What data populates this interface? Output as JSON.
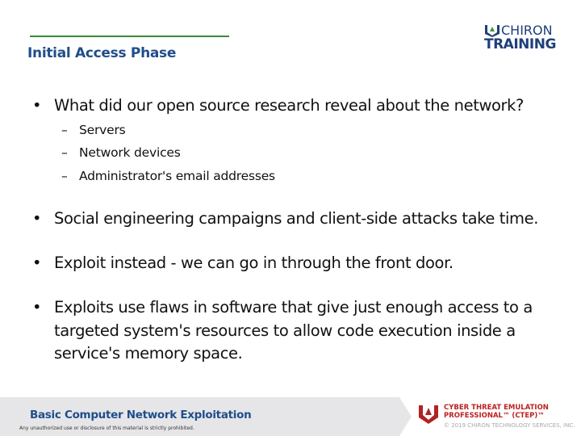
{
  "header": {
    "title": "Initial Access Phase",
    "logo": {
      "line1": "CHIRON",
      "line2": "TRAINING"
    }
  },
  "bullets": [
    {
      "text": "What did our open source research reveal about the network?",
      "sub": [
        "Servers",
        "Network devices",
        "Administrator's email addresses"
      ]
    },
    {
      "text": "Social engineering campaigns and client-side attacks take time."
    },
    {
      "text": "Exploit instead - we can go in through the front door."
    },
    {
      "text": "Exploits use flaws in software that give just enough access to a targeted system's resources to allow code execution inside a service's memory space."
    }
  ],
  "bullet_glyph": "•",
  "dash_glyph": "–",
  "footer": {
    "course": "Basic Computer Network Exploitation",
    "disclaimer": "Any unauthorized use or disclosure of this material is strictly prohibited.",
    "cert_line1": "CYBER THREAT EMULATION",
    "cert_line2": "PROFESSIONAL™ (CTEP)™",
    "copyright": "© 2019 CHIRON TECHNOLOGY SERVICES, INC."
  },
  "colors": {
    "title": "#1f4e8c",
    "rule": "#3a8a3a",
    "accent_red": "#b22222"
  }
}
